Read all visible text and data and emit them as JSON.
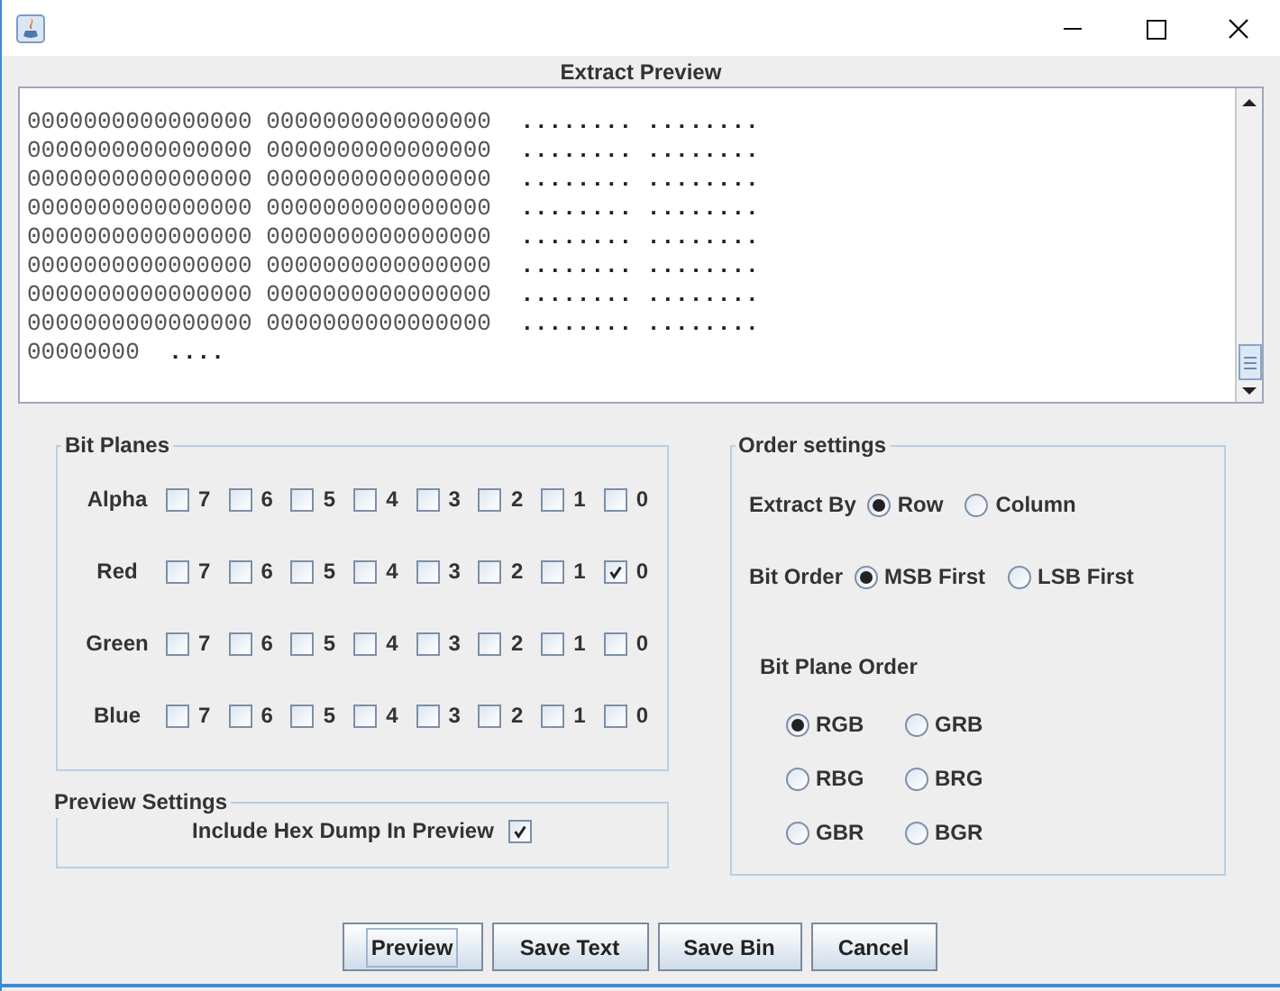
{
  "preview": {
    "header": "Extract Preview",
    "lines": [
      {
        "hex": "0000000000000000 0000000000000000",
        "text": "........ ........"
      },
      {
        "hex": "0000000000000000 0000000000000000",
        "text": "........ ........"
      },
      {
        "hex": "0000000000000000 0000000000000000",
        "text": "........ ........"
      },
      {
        "hex": "0000000000000000 0000000000000000",
        "text": "........ ........"
      },
      {
        "hex": "0000000000000000 0000000000000000",
        "text": "........ ........"
      },
      {
        "hex": "0000000000000000 0000000000000000",
        "text": "........ ........"
      },
      {
        "hex": "0000000000000000 0000000000000000",
        "text": "........ ........"
      },
      {
        "hex": "0000000000000000 0000000000000000",
        "text": "........ ........"
      },
      {
        "hex": "00000000",
        "text": "...."
      }
    ]
  },
  "bit_planes": {
    "title": "Bit Planes",
    "rows": [
      {
        "label": "Alpha",
        "bits": [
          {
            "label": "7",
            "checked": false
          },
          {
            "label": "6",
            "checked": false
          },
          {
            "label": "5",
            "checked": false
          },
          {
            "label": "4",
            "checked": false
          },
          {
            "label": "3",
            "checked": false
          },
          {
            "label": "2",
            "checked": false
          },
          {
            "label": "1",
            "checked": false
          },
          {
            "label": "0",
            "checked": false
          }
        ]
      },
      {
        "label": "Red",
        "bits": [
          {
            "label": "7",
            "checked": false
          },
          {
            "label": "6",
            "checked": false
          },
          {
            "label": "5",
            "checked": false
          },
          {
            "label": "4",
            "checked": false
          },
          {
            "label": "3",
            "checked": false
          },
          {
            "label": "2",
            "checked": false
          },
          {
            "label": "1",
            "checked": false
          },
          {
            "label": "0",
            "checked": true
          }
        ]
      },
      {
        "label": "Green",
        "bits": [
          {
            "label": "7",
            "checked": false
          },
          {
            "label": "6",
            "checked": false
          },
          {
            "label": "5",
            "checked": false
          },
          {
            "label": "4",
            "checked": false
          },
          {
            "label": "3",
            "checked": false
          },
          {
            "label": "2",
            "checked": false
          },
          {
            "label": "1",
            "checked": false
          },
          {
            "label": "0",
            "checked": false
          }
        ]
      },
      {
        "label": "Blue",
        "bits": [
          {
            "label": "7",
            "checked": false
          },
          {
            "label": "6",
            "checked": false
          },
          {
            "label": "5",
            "checked": false
          },
          {
            "label": "4",
            "checked": false
          },
          {
            "label": "3",
            "checked": false
          },
          {
            "label": "2",
            "checked": false
          },
          {
            "label": "1",
            "checked": false
          },
          {
            "label": "0",
            "checked": false
          }
        ]
      }
    ]
  },
  "preview_settings": {
    "title": "Preview Settings",
    "option": {
      "label": "Include Hex Dump In Preview",
      "checked": true
    }
  },
  "order_settings": {
    "title": "Order settings",
    "extract_by": {
      "label": "Extract By",
      "options": [
        {
          "label": "Row",
          "selected": true
        },
        {
          "label": "Column",
          "selected": false
        }
      ]
    },
    "bit_order": {
      "label": "Bit Order",
      "options": [
        {
          "label": "MSB First",
          "selected": true
        },
        {
          "label": "LSB First",
          "selected": false
        }
      ]
    },
    "bit_plane_order": {
      "title": "Bit Plane Order",
      "options": [
        {
          "label": "RGB",
          "selected": true
        },
        {
          "label": "GRB",
          "selected": false
        },
        {
          "label": "RBG",
          "selected": false
        },
        {
          "label": "BRG",
          "selected": false
        },
        {
          "label": "GBR",
          "selected": false
        },
        {
          "label": "BGR",
          "selected": false
        }
      ]
    }
  },
  "buttons": [
    {
      "label": "Preview",
      "focused": true
    },
    {
      "label": "Save Text",
      "focused": false
    },
    {
      "label": "Save Bin",
      "focused": false
    },
    {
      "label": "Cancel",
      "focused": false
    }
  ]
}
